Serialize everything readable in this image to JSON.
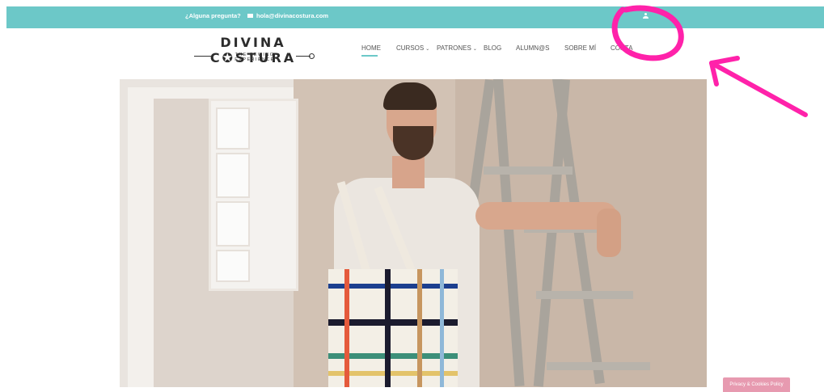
{
  "topbar": {
    "question": "¿Alguna pregunta?",
    "email": "hola@divinacostura.com"
  },
  "logo": {
    "title": "DIVINA CSTURA",
    "title_display": "DIVINA C✪STURA",
    "subtitle": "THE SEWING EXPERIENCE"
  },
  "nav": {
    "items": [
      {
        "label": "HOME"
      },
      {
        "label": "CURSOS"
      },
      {
        "label": "PATRONES"
      },
      {
        "label": "BLOG"
      },
      {
        "label": "ALUMN@S"
      },
      {
        "label": "SOBRE MÍ"
      },
      {
        "label": "CONTA"
      }
    ]
  },
  "footer": {
    "privacy_label": "Privacy & Cookies Policy"
  },
  "colors": {
    "topbar": "#6cc8c8",
    "annotation": "#ff22aa",
    "privacy": "#e79ab0"
  },
  "icons": {
    "mail": "mail-icon",
    "user": "user-icon",
    "chevron": "chevron-down-icon"
  }
}
